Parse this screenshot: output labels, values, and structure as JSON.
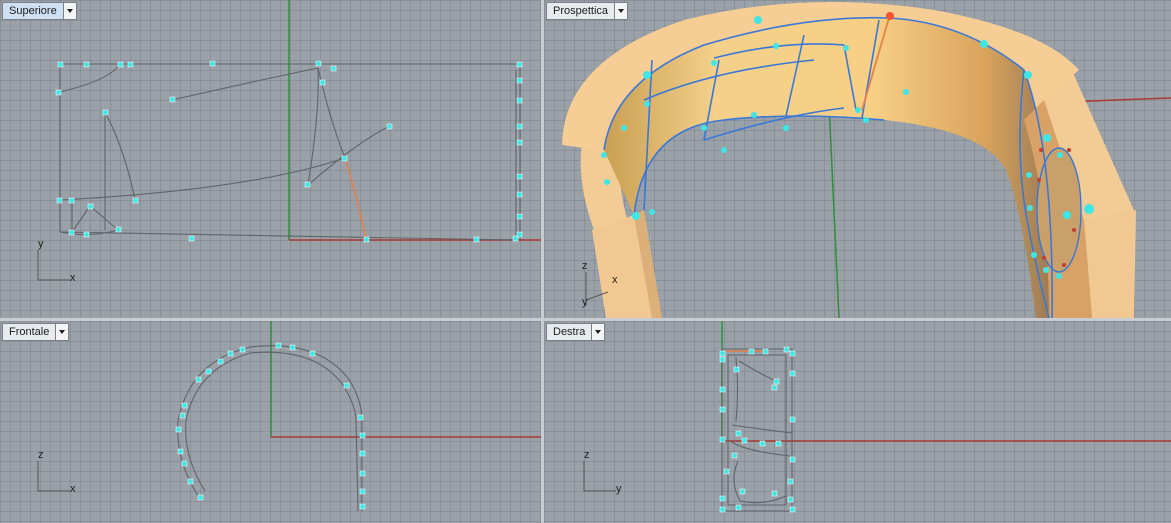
{
  "viewports": {
    "top": {
      "label": "Superiore",
      "axis_v": "y",
      "axis_h": "x",
      "active": true
    },
    "persp": {
      "label": "Prospettica",
      "axis_v": "z",
      "axis_h": "x",
      "axis_d": "y",
      "active": false
    },
    "front": {
      "label": "Frontale",
      "axis_v": "z",
      "axis_h": "x",
      "active": false
    },
    "right": {
      "label": "Destra",
      "axis_v": "z",
      "axis_h": "y",
      "active": false
    }
  },
  "colors": {
    "background": "#9aa1a8",
    "grid": "#7d848b",
    "x_axis": "#a83a32",
    "y_axis": "#2f8f3a",
    "control_point": "#3fe6e6",
    "curve": "#5f646a",
    "selected_curve": "#e4804a",
    "surface": "#f5c88c",
    "surface_edge": "#3a78d8"
  },
  "icons": {
    "dropdown": "chevron-down-icon"
  }
}
